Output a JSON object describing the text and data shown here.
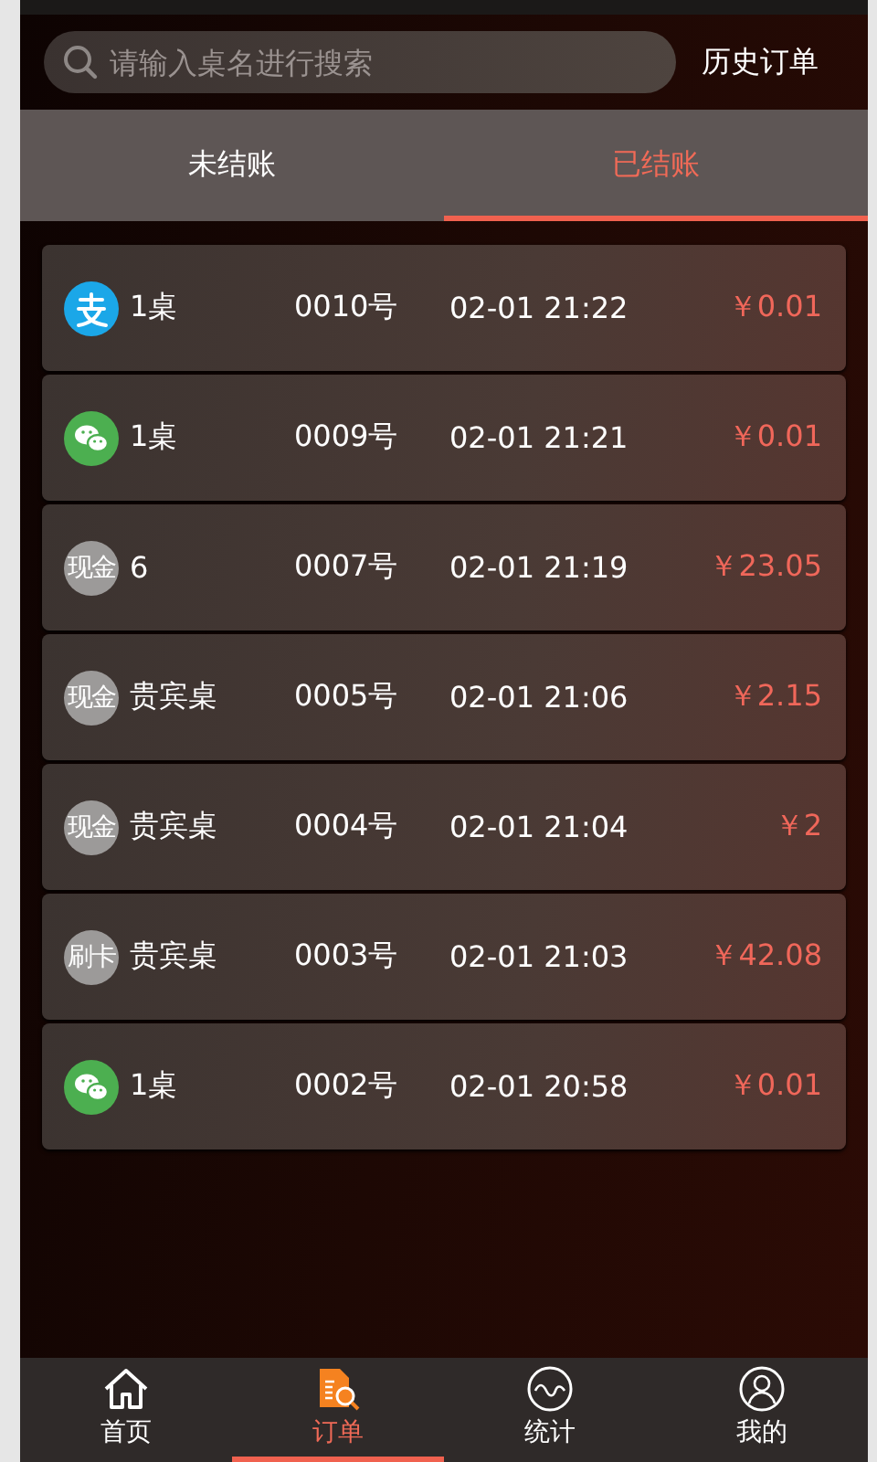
{
  "search": {
    "placeholder": "请输入桌名进行搜索"
  },
  "history_button": "历史订单",
  "tabs": [
    {
      "label": "未结账",
      "selected": false
    },
    {
      "label": "已结账",
      "selected": true
    }
  ],
  "orders": [
    {
      "kind": "alipay",
      "table": "1桌",
      "number": "0010号",
      "time": "02-01 21:22",
      "amount": "￥0.01"
    },
    {
      "kind": "wechat",
      "table": "1桌",
      "number": "0009号",
      "time": "02-01 21:21",
      "amount": "￥0.01"
    },
    {
      "kind": "text",
      "badge": "现金",
      "table": "6",
      "number": "0007号",
      "time": "02-01 21:19",
      "amount": "￥23.05"
    },
    {
      "kind": "text",
      "badge": "现金",
      "table": "贵宾桌",
      "number": "0005号",
      "time": "02-01 21:06",
      "amount": "￥2.15"
    },
    {
      "kind": "text",
      "badge": "现金",
      "table": "贵宾桌",
      "number": "0004号",
      "time": "02-01 21:04",
      "amount": "￥2"
    },
    {
      "kind": "text",
      "badge": "刷卡",
      "table": "贵宾桌",
      "number": "0003号",
      "time": "02-01 21:03",
      "amount": "￥42.08"
    },
    {
      "kind": "wechat",
      "table": "1桌",
      "number": "0002号",
      "time": "02-01 20:58",
      "amount": "￥0.01"
    }
  ],
  "nav": [
    {
      "kind": "home",
      "label": "首页",
      "selected": false
    },
    {
      "kind": "orders",
      "label": "订单",
      "selected": true
    },
    {
      "kind": "stats",
      "label": "统计",
      "selected": false
    },
    {
      "kind": "profile",
      "label": "我的",
      "selected": false
    }
  ]
}
